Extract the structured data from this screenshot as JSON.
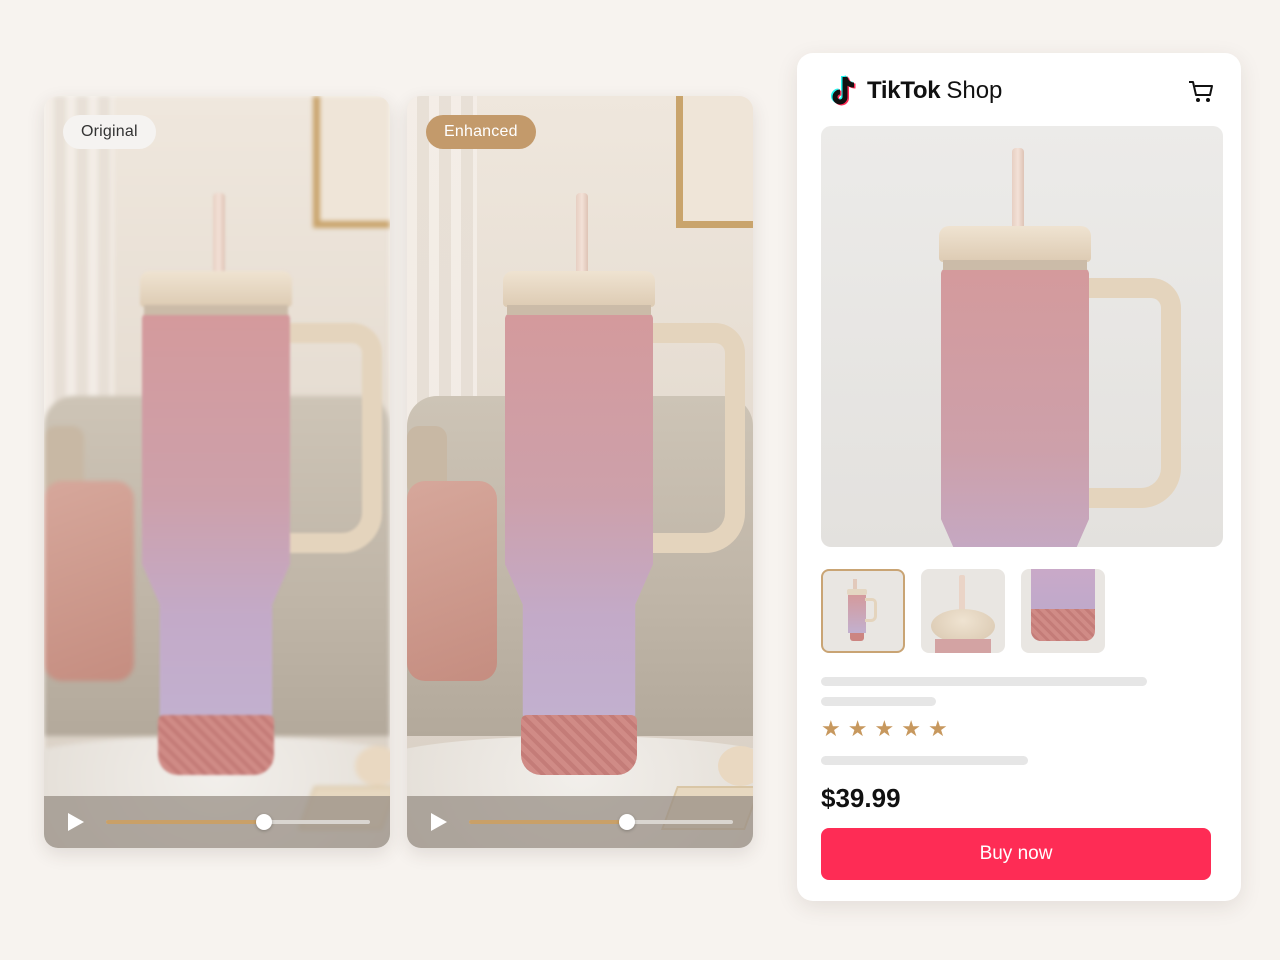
{
  "comparison": {
    "original": {
      "badge": "Original",
      "player": {
        "progress": 0.6
      }
    },
    "enhanced": {
      "badge": "Enhanced",
      "player": {
        "progress": 0.6
      }
    }
  },
  "shop": {
    "brand": "TikTok",
    "brand_suffix": "Shop",
    "price": "$39.99",
    "rating_stars": 5,
    "buy_label": "Buy now",
    "thumbnails": [
      "thumb-tumbler",
      "thumb-lid",
      "thumb-base"
    ],
    "selected_thumbnail": 0,
    "colors": {
      "buy_button": "#fe2c55",
      "star": "#c7985e",
      "badge_enhanced": "#c39a6b",
      "progress_fill": "#c9a068"
    }
  }
}
